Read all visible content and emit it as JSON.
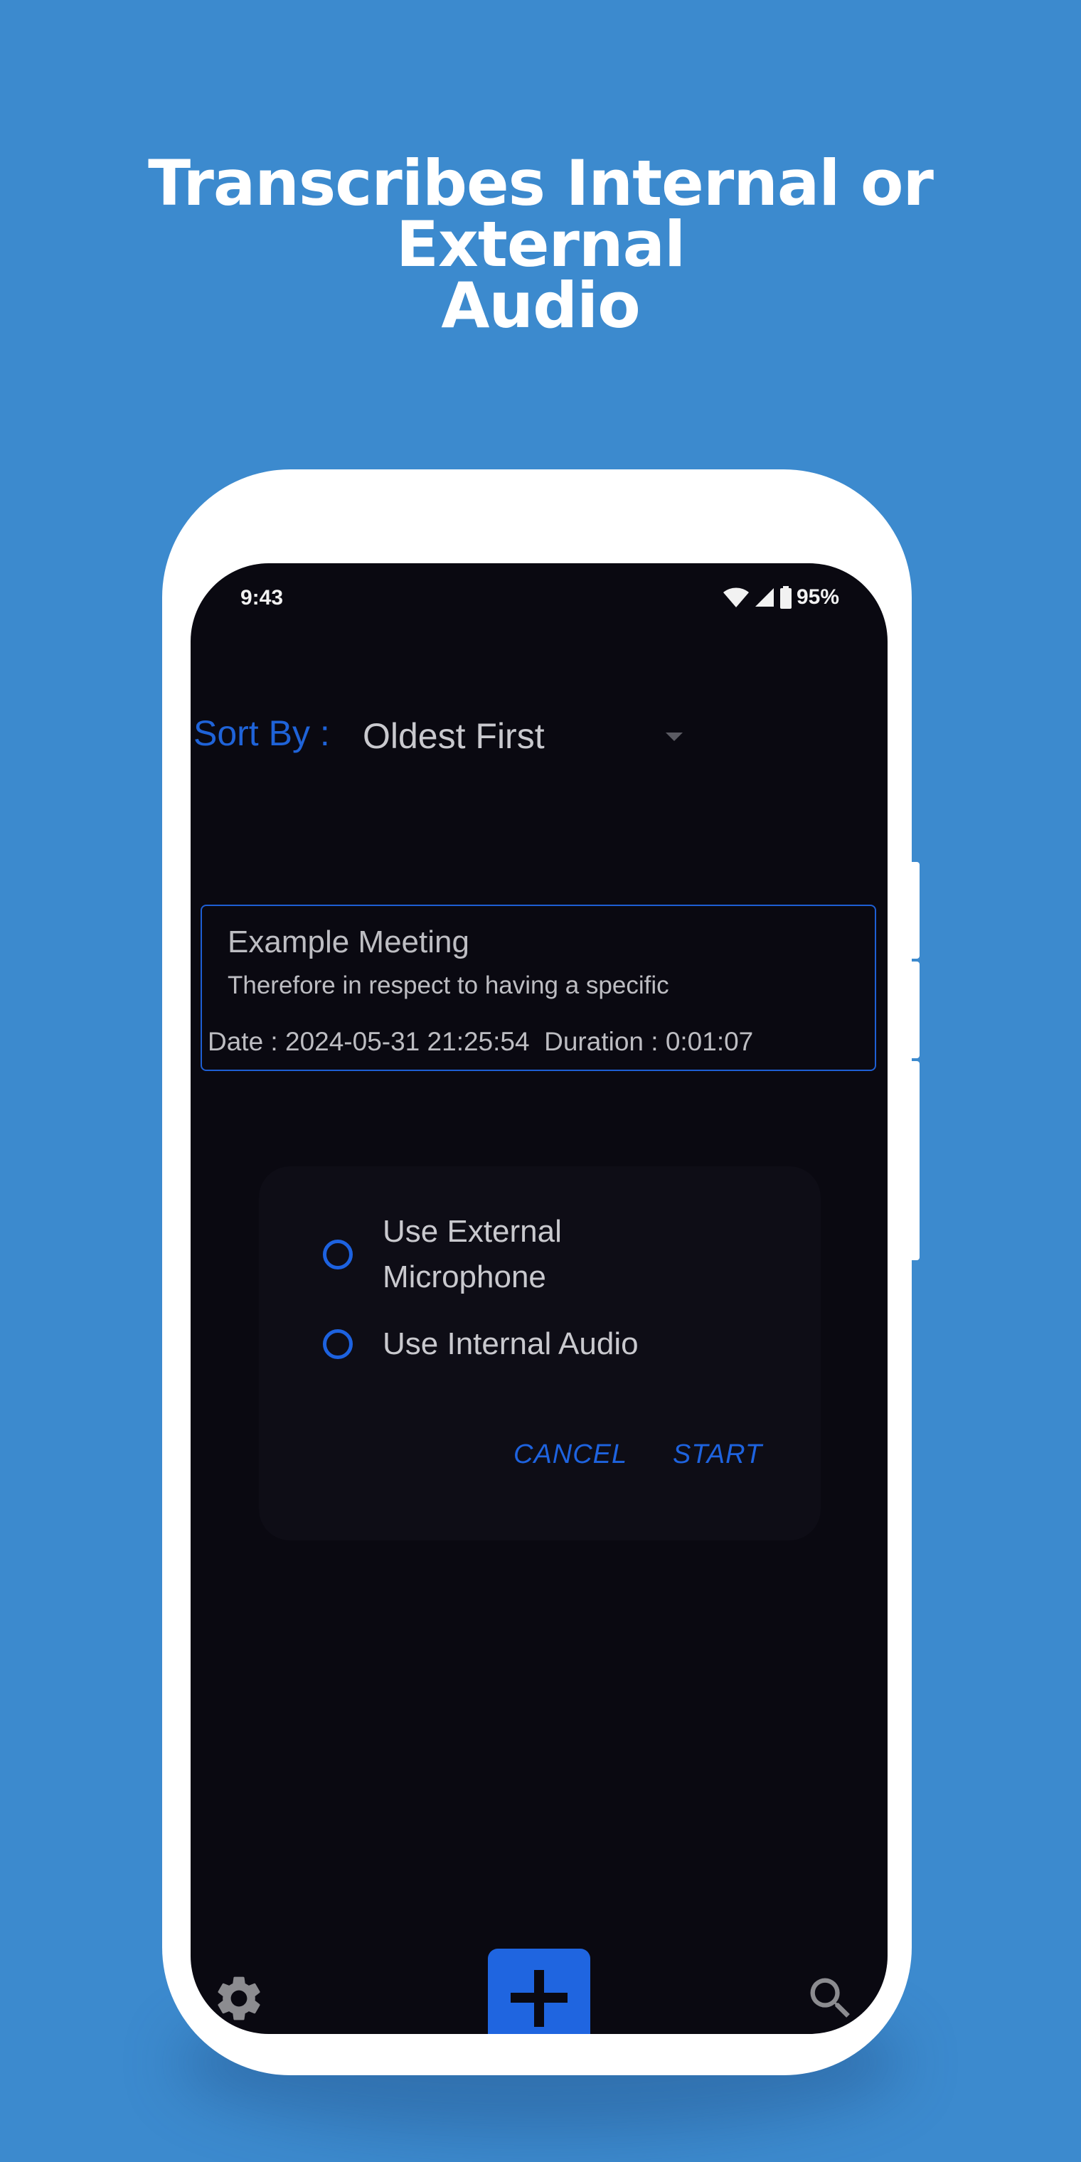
{
  "headline": {
    "line1": "Transcribes Internal or External",
    "line2": "Audio"
  },
  "status_bar": {
    "time": "9:43",
    "battery": "95%"
  },
  "sort": {
    "label": "Sort By :",
    "selected": "Oldest First"
  },
  "recordings": [
    {
      "title": "Example Meeting",
      "snippet": "Therefore in respect to having a specific",
      "meta": "Date : 2024-05-31 21:25:54  Duration : 0:01:07"
    }
  ],
  "dialog": {
    "options": [
      {
        "label": "Use External Microphone"
      },
      {
        "label": "Use Internal Audio"
      }
    ],
    "cancel_label": "CANCEL",
    "start_label": "START"
  },
  "bottom_bar": {
    "settings_icon": "gear-icon",
    "add_icon": "plus-icon",
    "search_icon": "search-icon"
  },
  "colors": {
    "background": "#3c8ace",
    "screen": "#0a0911",
    "accent": "#1f65e0"
  }
}
